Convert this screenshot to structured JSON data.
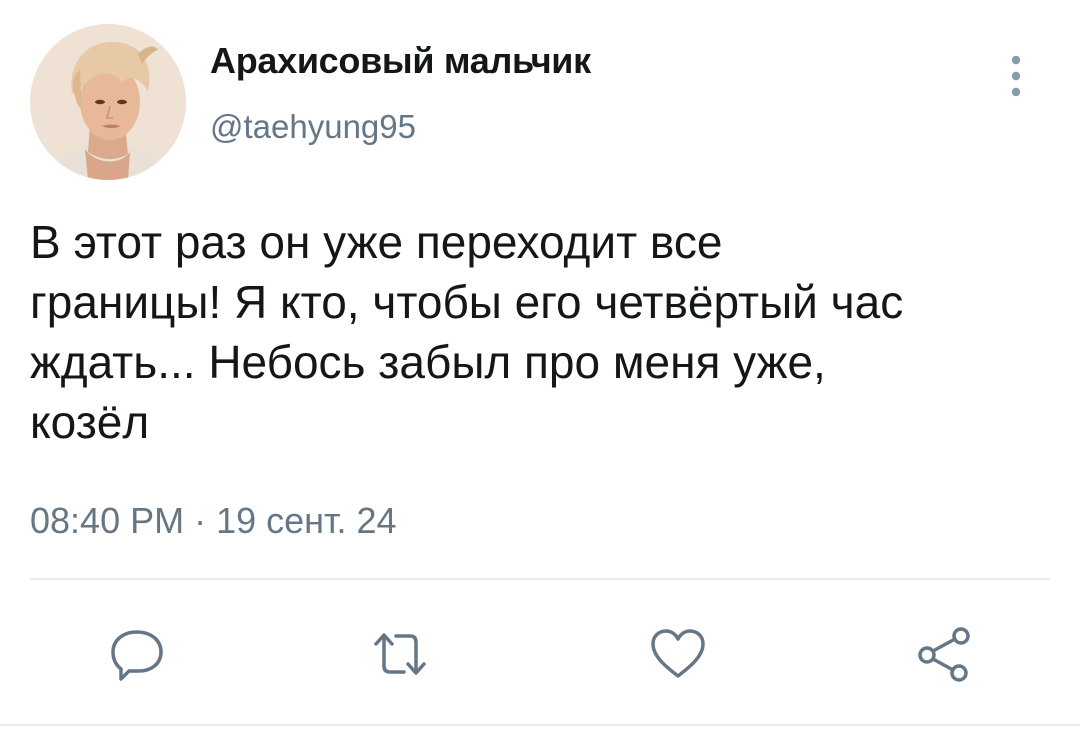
{
  "author": {
    "display_name": "Арахисовый мальчик",
    "handle": "@taehyung95"
  },
  "tweet": {
    "text": "В этот раз он уже переходит все\nграницы! Я кто, чтобы его четвёртый час\nждать... Небось забыл про меня уже,\nкозёл",
    "timestamp": "08:40 PM · 19 сент. 24"
  },
  "actions": [
    {
      "name": "reply",
      "icon": "reply-icon"
    },
    {
      "name": "retweet",
      "icon": "retweet-icon"
    },
    {
      "name": "like",
      "icon": "heart-icon"
    },
    {
      "name": "share",
      "icon": "share-icon"
    }
  ],
  "colors": {
    "text_primary": "#14171a",
    "text_secondary": "#657786",
    "divider": "#e6ecf0"
  }
}
